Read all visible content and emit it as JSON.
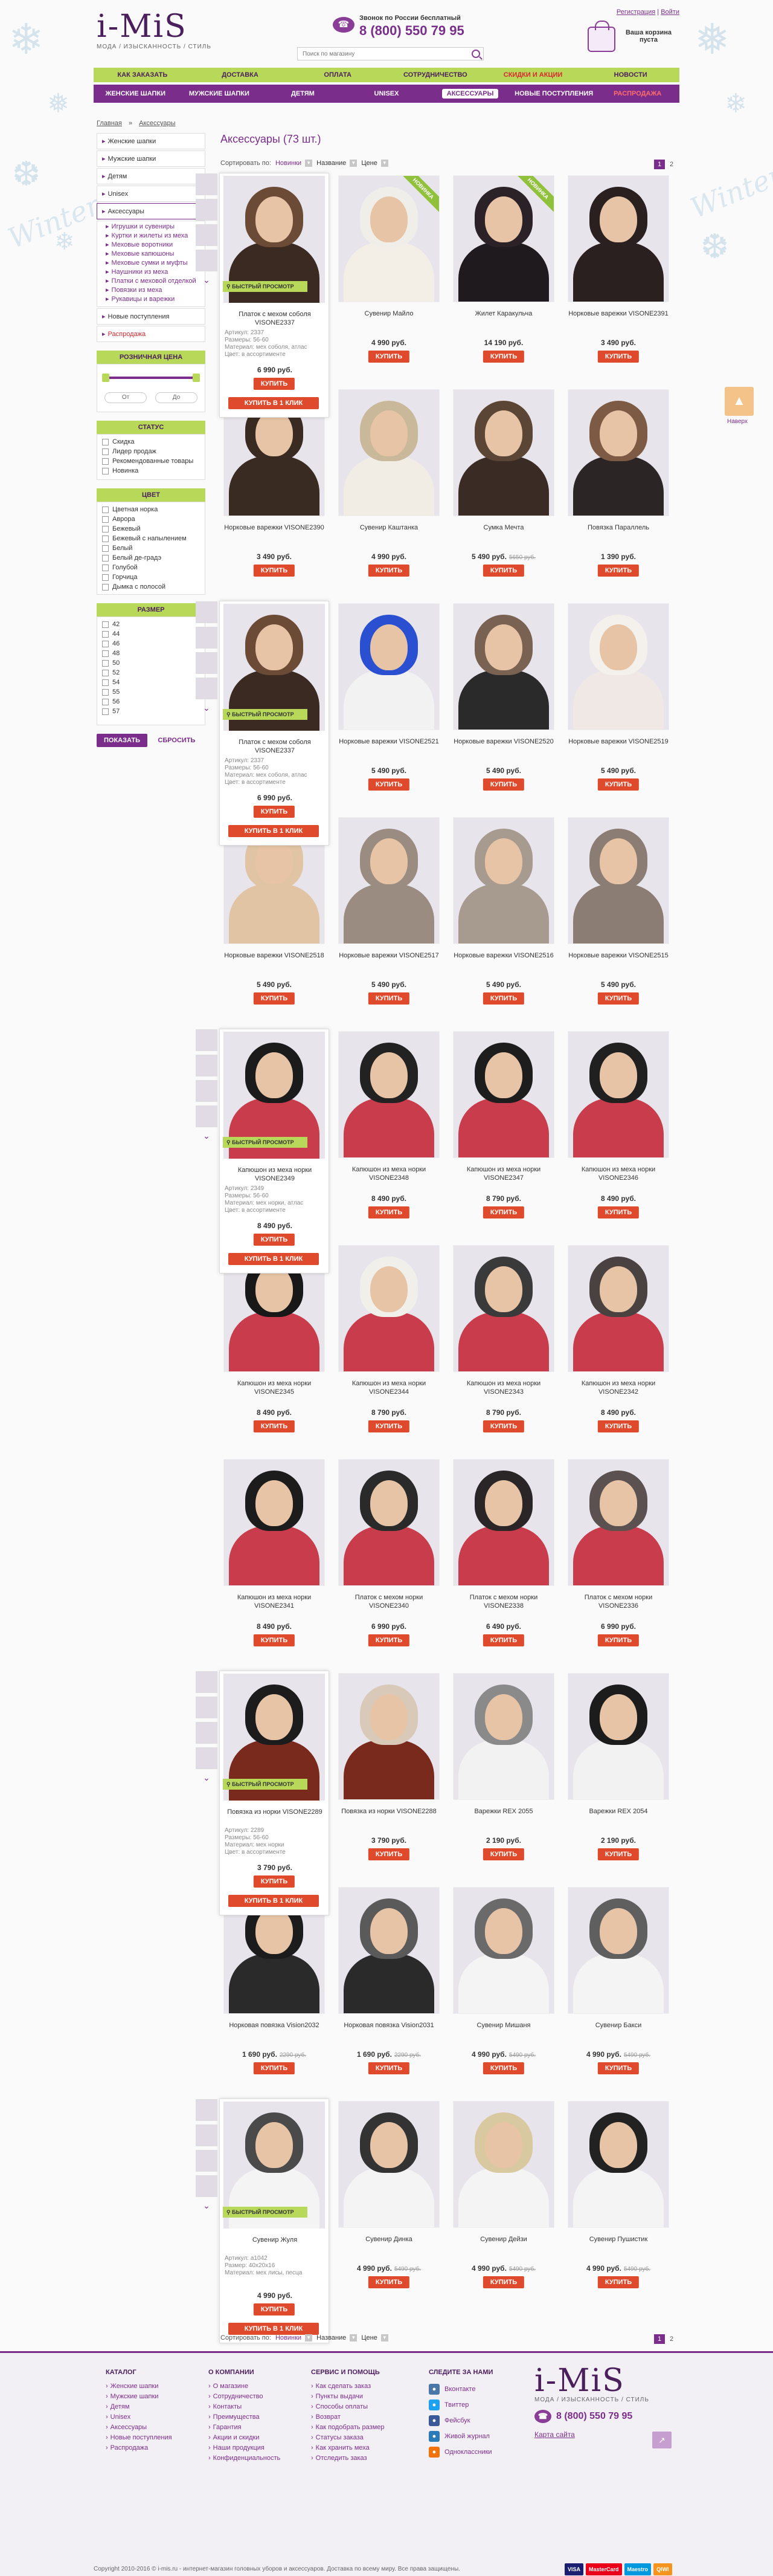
{
  "header": {
    "logo": "i-MiS",
    "tagline": "МОДА / ИЗЫСКАННОСТЬ / СТИЛЬ",
    "phone_label": "Звонок по России бесплатный",
    "phone": "8 (800) 550 79 95",
    "search_placeholder": "Поиск по магазину",
    "auth_register": "Регистрация",
    "auth_login": "Войти",
    "cart_text": "Ваша корзина пуста"
  },
  "nav_top": [
    "КАК ЗАКАЗАТЬ",
    "ДОСТАВКА",
    "ОПЛАТА",
    "СОТРУДНИЧЕСТВО",
    "СКИДКИ И АКЦИИ",
    "НОВОСТИ"
  ],
  "nav_main": [
    "ЖЕНСКИЕ ШАПКИ",
    "МУЖСКИЕ ШАПКИ",
    "ДЕТЯМ",
    "UNISEX",
    "АКСЕССУАРЫ",
    "НОВЫЕ ПОСТУПЛЕНИЯ",
    "РАСПРОДАЖА"
  ],
  "breadcrumb": [
    "Главная",
    "Аксессуары"
  ],
  "sidebar": {
    "cats": [
      "Женские шапки",
      "Мужские шапки",
      "Детям",
      "Unisex",
      "Аксессуары"
    ],
    "sub": [
      "Игрушки и сувениры",
      "Куртки и жилеты из меха",
      "Меховые воротники",
      "Меховые капюшоны",
      "Меховые сумки и муфты",
      "Наушники из меха",
      "Платки с меховой отделкой",
      "Повязки из меха",
      "Рукавицы и варежки"
    ],
    "cats2": [
      "Новые поступления",
      "Распродажа"
    ],
    "price_title": "РОЗНИЧНАЯ ЦЕНА",
    "price_from": "От",
    "price_to": "До",
    "status_title": "СТАТУС",
    "status": [
      "Скидка",
      "Лидер продаж",
      "Рекомендованные товары",
      "Новинка"
    ],
    "color_title": "ЦВЕТ",
    "colors": [
      "Цветная норка",
      "Аврора",
      "Бежевый",
      "Бежевый с напылением",
      "Белый",
      "Белый де-градэ",
      "Голубой",
      "Горчица",
      "Дымка с полосой"
    ],
    "size_title": "РАЗМЕР",
    "sizes": [
      "42",
      "44",
      "46",
      "48",
      "50",
      "52",
      "54",
      "55",
      "56",
      "57"
    ],
    "show_btn": "ПОКАЗАТЬ",
    "reset_btn": "СБРОСИТЬ"
  },
  "content": {
    "title": "Аксессуары (73 шт.)",
    "sort_label": "Сортировать по:",
    "sort_new": "Новинки",
    "sort_name": "Название",
    "sort_price": "Цене",
    "pages": [
      "1",
      "2"
    ]
  },
  "labels": {
    "buy": "КУПИТЬ",
    "quick": "БЫСТРЫЙ ПРОСМОТР",
    "one_click": "КУПИТЬ В 1 КЛИК",
    "new_badge": "НОВИНКА",
    "up": "Наверх"
  },
  "products": [
    {
      "name": "Платок с мехом соболя VISONE2337",
      "price": "6 990 руб.",
      "old": ""
    },
    {
      "name": "Сувенир Майло",
      "price": "4 990 руб.",
      "old": ""
    },
    {
      "name": "Жилет Каракульча",
      "price": "14 190 руб.",
      "old": ""
    },
    {
      "name": "Норковые варежки VISONE2391",
      "price": "3 490 руб.",
      "old": ""
    },
    {
      "name": "Норковые варежки VISONE2390",
      "price": "3 490 руб.",
      "old": ""
    },
    {
      "name": "Сувенир Каштанка",
      "price": "4 990 руб.",
      "old": ""
    },
    {
      "name": "Сумка Мечта",
      "price": "5 490 руб.",
      "old": "5650 руб."
    },
    {
      "name": "Повязка Параллель",
      "price": "1 390 руб.",
      "old": ""
    },
    {
      "name": "Платок с мехом соболя VISONE2337",
      "price": "6 990 руб.",
      "old": ""
    },
    {
      "name": "Норковые варежки VISONE2521",
      "price": "5 490 руб.",
      "old": ""
    },
    {
      "name": "Норковые варежки VISONE2520",
      "price": "5 490 руб.",
      "old": ""
    },
    {
      "name": "Норковые варежки VISONE2519",
      "price": "5 490 руб.",
      "old": ""
    },
    {
      "name": "Норковые варежки VISONE2518",
      "price": "5 490 руб.",
      "old": ""
    },
    {
      "name": "Норковые варежки VISONE2517",
      "price": "5 490 руб.",
      "old": ""
    },
    {
      "name": "Норковые варежки VISONE2516",
      "price": "5 490 руб.",
      "old": ""
    },
    {
      "name": "Норковые варежки VISONE2515",
      "price": "5 490 руб.",
      "old": ""
    },
    {
      "name": "Капюшон из меха норки VISONE2349",
      "price": "8 490 руб.",
      "old": ""
    },
    {
      "name": "Капюшон из меха норки VISONE2348",
      "price": "8 490 руб.",
      "old": ""
    },
    {
      "name": "Капюшон из меха норки VISONE2347",
      "price": "8 790 руб.",
      "old": ""
    },
    {
      "name": "Капюшон из меха норки VISONE2346",
      "price": "8 490 руб.",
      "old": ""
    },
    {
      "name": "Капюшон из меха норки VISONE2345",
      "price": "8 490 руб.",
      "old": ""
    },
    {
      "name": "Капюшон из меха норки VISONE2344",
      "price": "8 790 руб.",
      "old": ""
    },
    {
      "name": "Капюшон из меха норки VISONE2343",
      "price": "8 790 руб.",
      "old": ""
    },
    {
      "name": "Капюшон из меха норки VISONE2342",
      "price": "8 490 руб.",
      "old": ""
    },
    {
      "name": "Капюшон из меха норки VISONE2341",
      "price": "8 490 руб.",
      "old": ""
    },
    {
      "name": "Платок с мехом норки VISONE2340",
      "price": "6 990 руб.",
      "old": ""
    },
    {
      "name": "Платок с мехом норки VISONE2338",
      "price": "6 490 руб.",
      "old": ""
    },
    {
      "name": "Платок с мехом норки VISONE2336",
      "price": "6 990 руб.",
      "old": ""
    },
    {
      "name": "Повязка из норки VISONE2289",
      "price": "3 790 руб.",
      "old": ""
    },
    {
      "name": "Повязка из норки VISONE2288",
      "price": "3 790 руб.",
      "old": ""
    },
    {
      "name": "Варежки REX 2055",
      "price": "2 190 руб.",
      "old": ""
    },
    {
      "name": "Варежки REX 2054",
      "price": "2 190 руб.",
      "old": ""
    },
    {
      "name": "Норковая повязка Vision2032",
      "price": "1 690 руб.",
      "old": "2290 руб."
    },
    {
      "name": "Норковая повязка Vision2031",
      "price": "1 690 руб.",
      "old": "2290 руб."
    },
    {
      "name": "Сувенир Мишаня",
      "price": "4 990 руб.",
      "old": "5490 руб."
    },
    {
      "name": "Сувенир Бакси",
      "price": "4 990 руб.",
      "old": "5490 руб."
    },
    {
      "name": "Сувенир Жуля",
      "price": "4 990 руб.",
      "old": ""
    },
    {
      "name": "Сувенир Динка",
      "price": "4 990 руб.",
      "old": "5490 руб."
    },
    {
      "name": "Сувенир Дейзи",
      "price": "4 990 руб.",
      "old": "5490 руб."
    },
    {
      "name": "Сувенир Пушистик",
      "price": "4 990 руб.",
      "old": "5490 руб."
    }
  ],
  "popups": [
    {
      "meta": "Артикул: 2337\nРазмеры: 56-60\nМатериал: мех соболя, атлас\nЦвет: в ассортименте",
      "price": "6 990 руб."
    },
    {
      "meta": "Артикул: 2337\nРазмеры: 56-60\nМатериал: мех соболя, атлас\nЦвет: в ассортименте",
      "price": "6 990 руб."
    },
    {
      "meta": "Артикул: 2349\nРазмеры: 56-60\nМатериал: мех норки, атлас\nЦвет: в ассортименте",
      "price": "8 490 руб."
    },
    {
      "meta": "Артикул: 2289\nРазмеры: 56-60\nМатериал: мех норки\nЦвет: в ассортименте",
      "price": "3 790 руб."
    },
    {
      "meta": "Артикул: a1042\nРазмер: 40x20x16\nМатериал: мех лисы, песца",
      "price": "4 990 руб."
    }
  ],
  "footer": {
    "catalog_title": "КАТАЛОГ",
    "catalog": [
      "Женские шапки",
      "Мужские шапки",
      "Детям",
      "Unisex",
      "Аксессуары",
      "Новые поступления",
      "Распродажа"
    ],
    "company_title": "О КОМПАНИИ",
    "company": [
      "О магазине",
      "Сотрудничество",
      "Контакты",
      "Преимущества",
      "Гарантия",
      "Акции и скидки",
      "Наши продукция",
      "Конфиденциальность"
    ],
    "service_title": "СЕРВИС И ПОМОЩЬ",
    "service": [
      "Как сделать заказ",
      "Пункты выдачи",
      "Способы оплаты",
      "Возврат",
      "Как подобрать размер",
      "Статусы заказа",
      "Как хранить меха",
      "Отследить заказ"
    ],
    "social_title": "СЛЕДИТЕ ЗА НАМИ",
    "social": [
      "Вконтакте",
      "Твиттер",
      "Фейсбук",
      "Живой журнал",
      "Одноклассники"
    ],
    "phone": "8 (800) 550 79 95",
    "map": "Карта сайта",
    "copyright": "Copyright 2010-2016 © i-mis.ru - интернет-магазин головных уборов и аксессуаров. Доставка по всему миру. Все права защищены.",
    "pay": [
      "VISA",
      "MasterCard",
      "Maestro",
      "QIWI"
    ]
  },
  "decor": {
    "winter": "Winter"
  },
  "colors": {
    "brand": "#7b2d8c",
    "accent_green": "#b8d85a",
    "buy": "#e04a2c"
  }
}
